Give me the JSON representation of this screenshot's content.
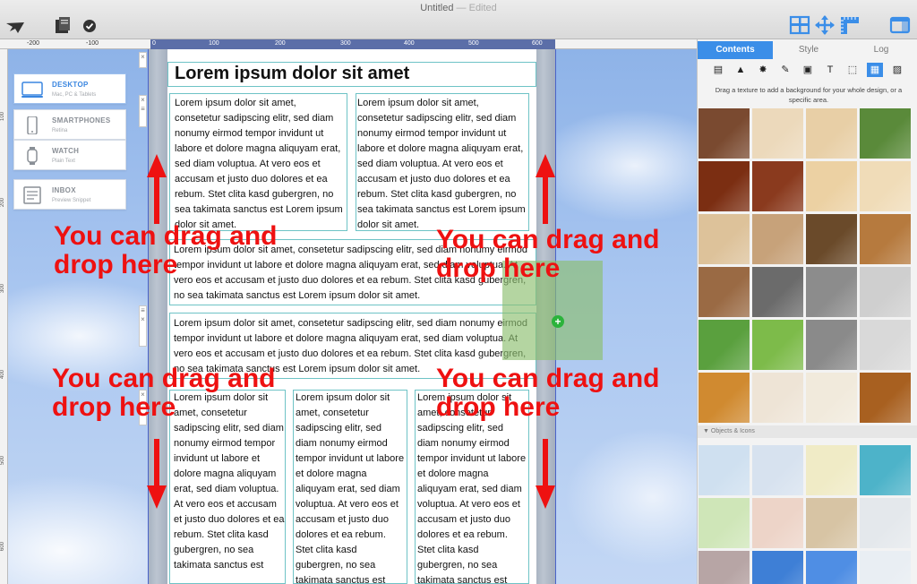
{
  "window": {
    "title": "Untitled",
    "status": "— Edited"
  },
  "toolbar": {
    "left_icons": [
      "preview-icon",
      "server-icon",
      "check-icon"
    ],
    "right_icons": [
      "layout-icon",
      "move-icon",
      "ruler-icon",
      "sidebar-icon"
    ]
  },
  "ruler": {
    "h_ticks": [
      "-200",
      "-100",
      "0",
      "100",
      "200",
      "300",
      "400",
      "500",
      "600"
    ],
    "v_ticks": [
      "100",
      "200",
      "300",
      "400",
      "500",
      "600"
    ]
  },
  "devices": [
    {
      "name": "DESKTOP",
      "sub": "Mac, PC & Tablets",
      "icon": "desktop-icon"
    },
    {
      "name": "SMARTPHONES",
      "sub": "Retina",
      "icon": "smartphone-icon"
    },
    {
      "name": "WATCH",
      "sub": "Plain Text",
      "icon": "watch-icon"
    },
    {
      "name": "INBOX",
      "sub": "Preview Snippet",
      "icon": "inbox-icon"
    }
  ],
  "email": {
    "heading": "Lorem ipsum dolor sit amet",
    "two_col_text": "Lorem ipsum dolor sit amet, consetetur sadipscing elitr, sed diam nonumy eirmod tempor invidunt ut labore et dolore magna aliquyam erat, sed diam voluptua. At vero eos et accusam et justo duo dolores et ea rebum. Stet clita kasd gubergren, no sea takimata sanctus est Lorem ipsum dolor sit amet.",
    "full_text": "Lorem ipsum dolor sit amet, consetetur sadipscing elitr, sed diam nonumy eirmod tempor invidunt ut labore et dolore magna aliquyam erat, sed diam voluptua. At vero eos et accusam et justo duo dolores et ea rebum. Stet clita kasd gubergren, no sea takimata sanctus est Lorem ipsum dolor sit amet.",
    "three_col_text": "Lorem ipsum dolor sit amet, consetetur sadipscing elitr, sed diam nonumy eirmod tempor invidunt ut labore et dolore magna aliquyam erat, sed diam voluptua. At vero eos et accusam et justo duo dolores et ea rebum. Stet clita kasd gubergren, no sea takimata sanctus est"
  },
  "annotations": {
    "drop_label": "You can drag and drop here",
    "color": "#ee1111"
  },
  "panel": {
    "tabs": [
      "Contents",
      "Style",
      "Log"
    ],
    "active_tab": "Contents",
    "tools": [
      "save-icon",
      "triangle-icon",
      "badge-icon",
      "brush-icon",
      "button-icon",
      "text-icon",
      "selection-icon",
      "texture-icon",
      "image-icon"
    ],
    "hint": "Drag a texture to add a background for your whole design, or a specific area.",
    "section_label": "Objects & Icons",
    "textures": [
      "#7a4a30",
      "#ecd9bb",
      "#e8cfa6",
      "#5a8a3a",
      "#7b2e12",
      "#8a3a1e",
      "#ecd1a3",
      "#f0dcb8",
      "#ddc29a",
      "#c7a27a",
      "#6a4a2a",
      "#b67a3e",
      "#9a6a44",
      "#6b6b6b",
      "#8c8c8c",
      "#cfcfcf",
      "#5aa03e",
      "#7dbb4a",
      "#8a8a8a",
      "#d9d9d9",
      "#d08a30",
      "#eee4d6",
      "#f1eadc",
      "#a86020",
      "#cfe0f0",
      "#d7e2ef",
      "#f0ebc6",
      "#4db3c9",
      "#cfe6b8",
      "#edd4c8",
      "#d7c4a4",
      "#e4e8ec",
      "#b7a5a5",
      "#3e7fd6",
      "#4f8ee4",
      "#e9eef3"
    ]
  }
}
